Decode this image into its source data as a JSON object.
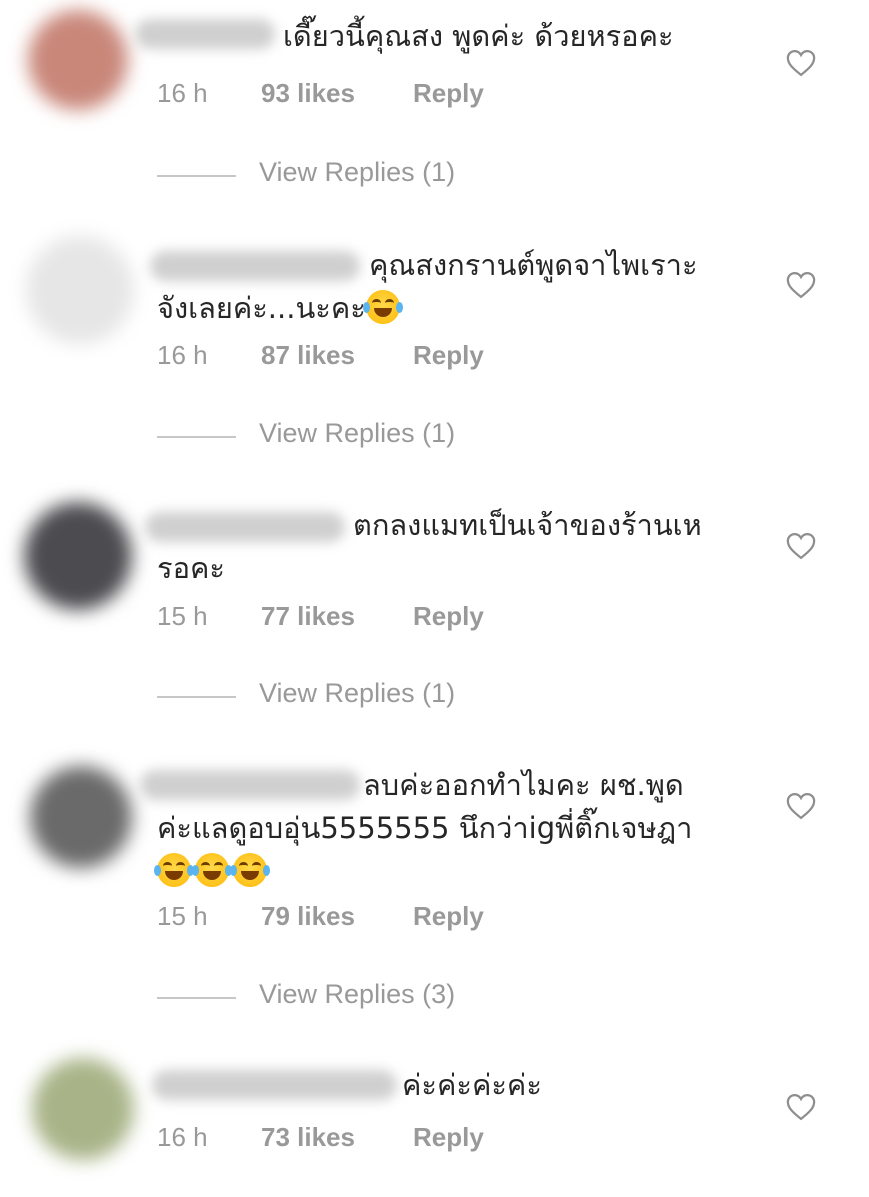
{
  "comments": [
    {
      "text": "เดี๊ยวนี้คุณสง พูดค่ะ ด้วยหรอคะ",
      "time": "16 h",
      "likes": "93 likes",
      "reply": "Reply",
      "view_replies": "View Replies (1)",
      "avatar_color": "#c9877a"
    },
    {
      "text": "คุณสงกรานต์พูดจาไพเราะ",
      "text_line2": "จังเลยค่ะ...นะคะ",
      "time": "16 h",
      "likes": "87 likes",
      "reply": "Reply",
      "view_replies": "View Replies (1)",
      "avatar_color": "#e2e2e2"
    },
    {
      "text": "ตกลงแมทเป็นเจ้าของร้านเห",
      "text_line2": "รอคะ",
      "time": "15 h",
      "likes": "77 likes",
      "reply": "Reply",
      "view_replies": "View Replies (1)",
      "avatar_color": "#4a4a4e"
    },
    {
      "text": "ลบค่ะออกทำไมคะ ผช.พูด",
      "text_line2": "ค่ะแลดูอบอุ่น5555555 นึกว่าigพี่ติ๊กเจษฎา",
      "time": "15 h",
      "likes": "79 likes",
      "reply": "Reply",
      "view_replies": "View Replies (3)",
      "avatar_color": "#6a6a6a"
    },
    {
      "text": "ค่ะค่ะค่ะค่ะ",
      "time": "16 h",
      "likes": "73 likes",
      "reply": "Reply",
      "avatar_color": "#a6b287"
    }
  ],
  "icons": {
    "like": "heart-outline-icon",
    "emoji": "face-with-tears-of-joy"
  },
  "colors": {
    "text": "#262626",
    "meta": "#999999",
    "divider": "#c7c7c7"
  }
}
